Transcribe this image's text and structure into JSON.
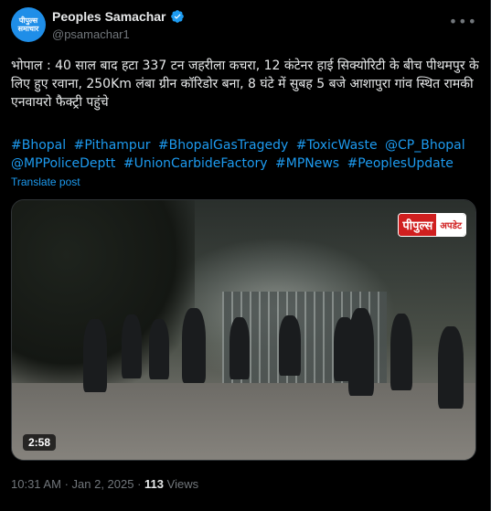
{
  "account": {
    "display_name": "Peoples Samachar",
    "handle": "@psamachar1",
    "avatar_text_1": "पीपुल्स",
    "avatar_text_2": "समाचार",
    "verified_color": "#1d9bf0"
  },
  "post": {
    "text": "भोपाल : 40 साल बाद हटा 337 टन जहरीला कचरा, 12 कंटेनर हाई सिक्योरिटी के बीच पीथमपुर के लिए हुए रवाना, 250Km लंबा ग्रीन कॉरिडोर बना, 8 घंटे में सुबह 5 बजे आशापुरा गांव स्थित रामकी एनवायरो फैक्ट्री पहुंचे",
    "hashtags": [
      "#Bhopal",
      "#Pithampur",
      "#BhopalGasTragedy",
      "#ToxicWaste",
      "@CP_Bhopal",
      "@MPPoliceDeptt",
      "#UnionCarbideFactory",
      "#MPNews",
      "#PeoplesUpdate"
    ],
    "translate_label": "Translate post"
  },
  "media": {
    "badge_main": "पीपुल्स",
    "badge_sub": "अपडेट",
    "duration": "2:58",
    "badge_color": "#d01f1f"
  },
  "meta": {
    "time": "10:31 AM",
    "date": "Jan 2, 2025",
    "views_count": "113",
    "views_label": "Views"
  },
  "icons": [
    "more-icon",
    "verified-badge-icon"
  ]
}
